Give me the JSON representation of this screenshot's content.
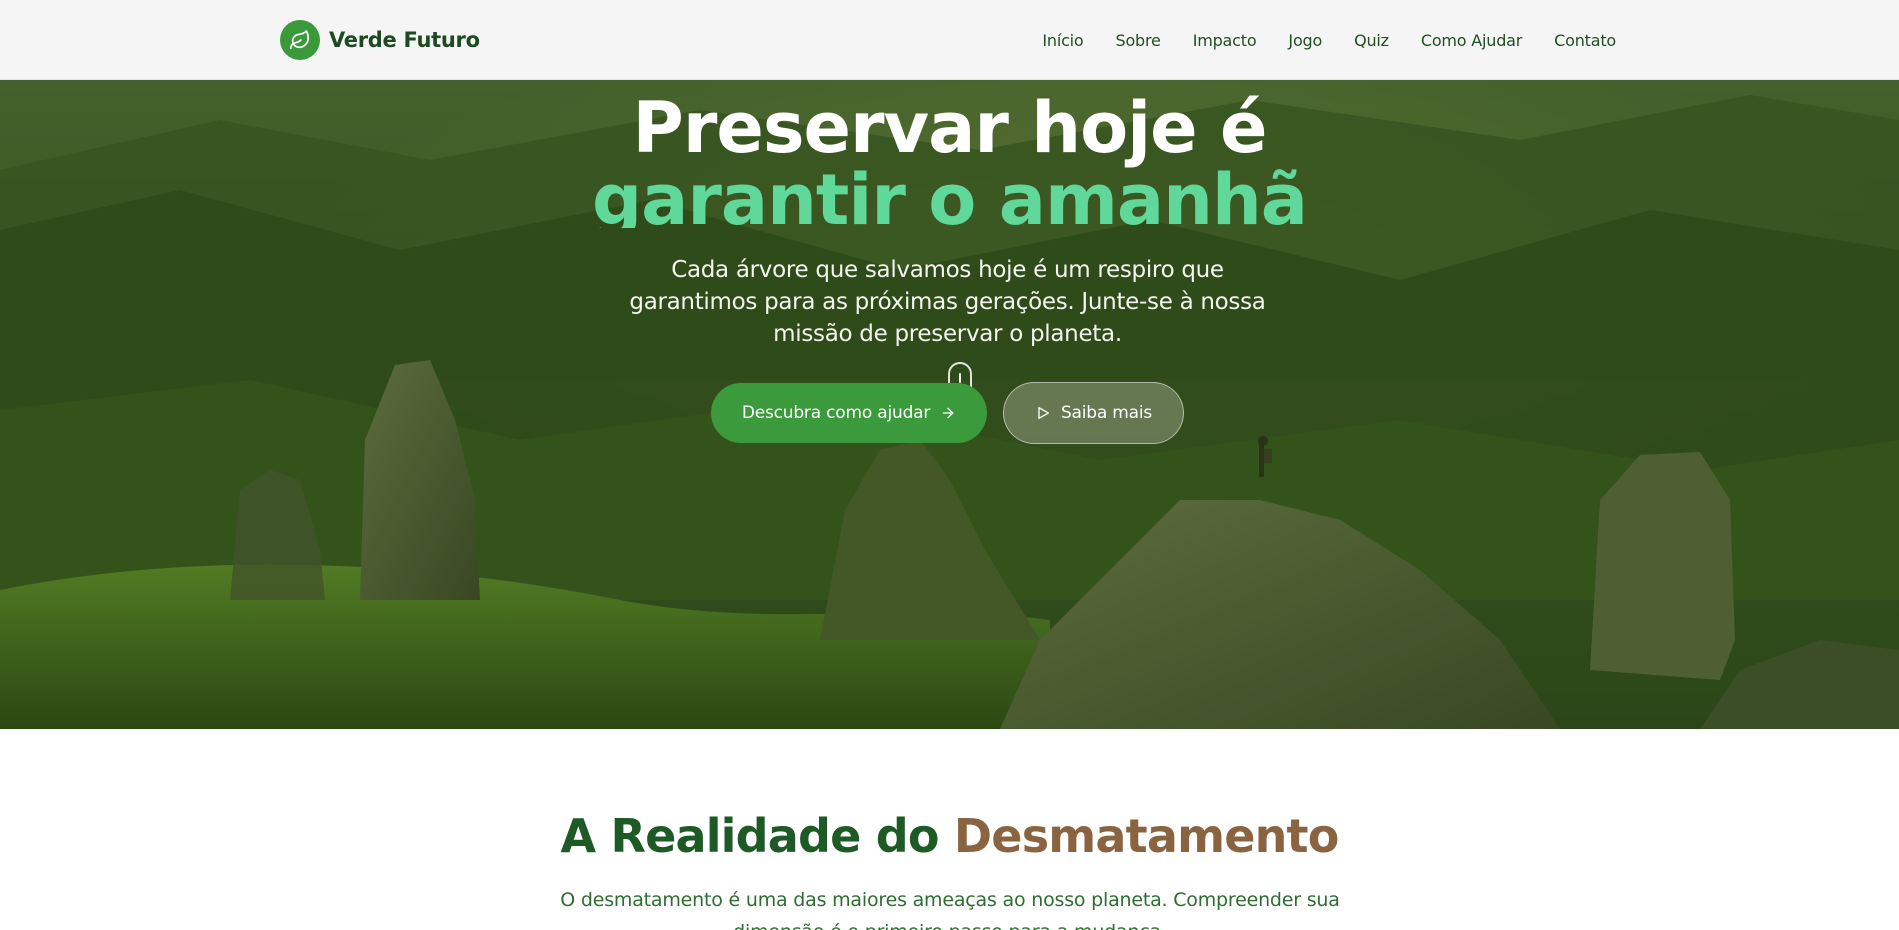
{
  "brand": {
    "name": "Verde Futuro",
    "logo_icon": "leaf-icon"
  },
  "nav": {
    "items": [
      "Início",
      "Sobre",
      "Impacto",
      "Jogo",
      "Quiz",
      "Como Ajudar",
      "Contato"
    ]
  },
  "hero": {
    "title_line1": "Preservar hoje é",
    "title_line2": "garantir o amanhã",
    "subtitle": "Cada árvore que salvamos hoje é um respiro que garantimos para as próximas gerações. Junte-se à nossa missão de preservar o planeta.",
    "primary_button": "Descubra como ajudar",
    "secondary_button": "Saiba mais"
  },
  "section": {
    "title_part1": "A Realidade do ",
    "title_part2": "Desmatamento",
    "text": "O desmatamento é uma das maiores ameaças ao nosso planeta. Compreender sua dimensão é o primeiro passo para a mudança."
  },
  "colors": {
    "brand_green": "#3a9a3a",
    "accent_green": "#5fd89a",
    "dark_green": "#1e5a25",
    "brown": "#8a6441"
  }
}
